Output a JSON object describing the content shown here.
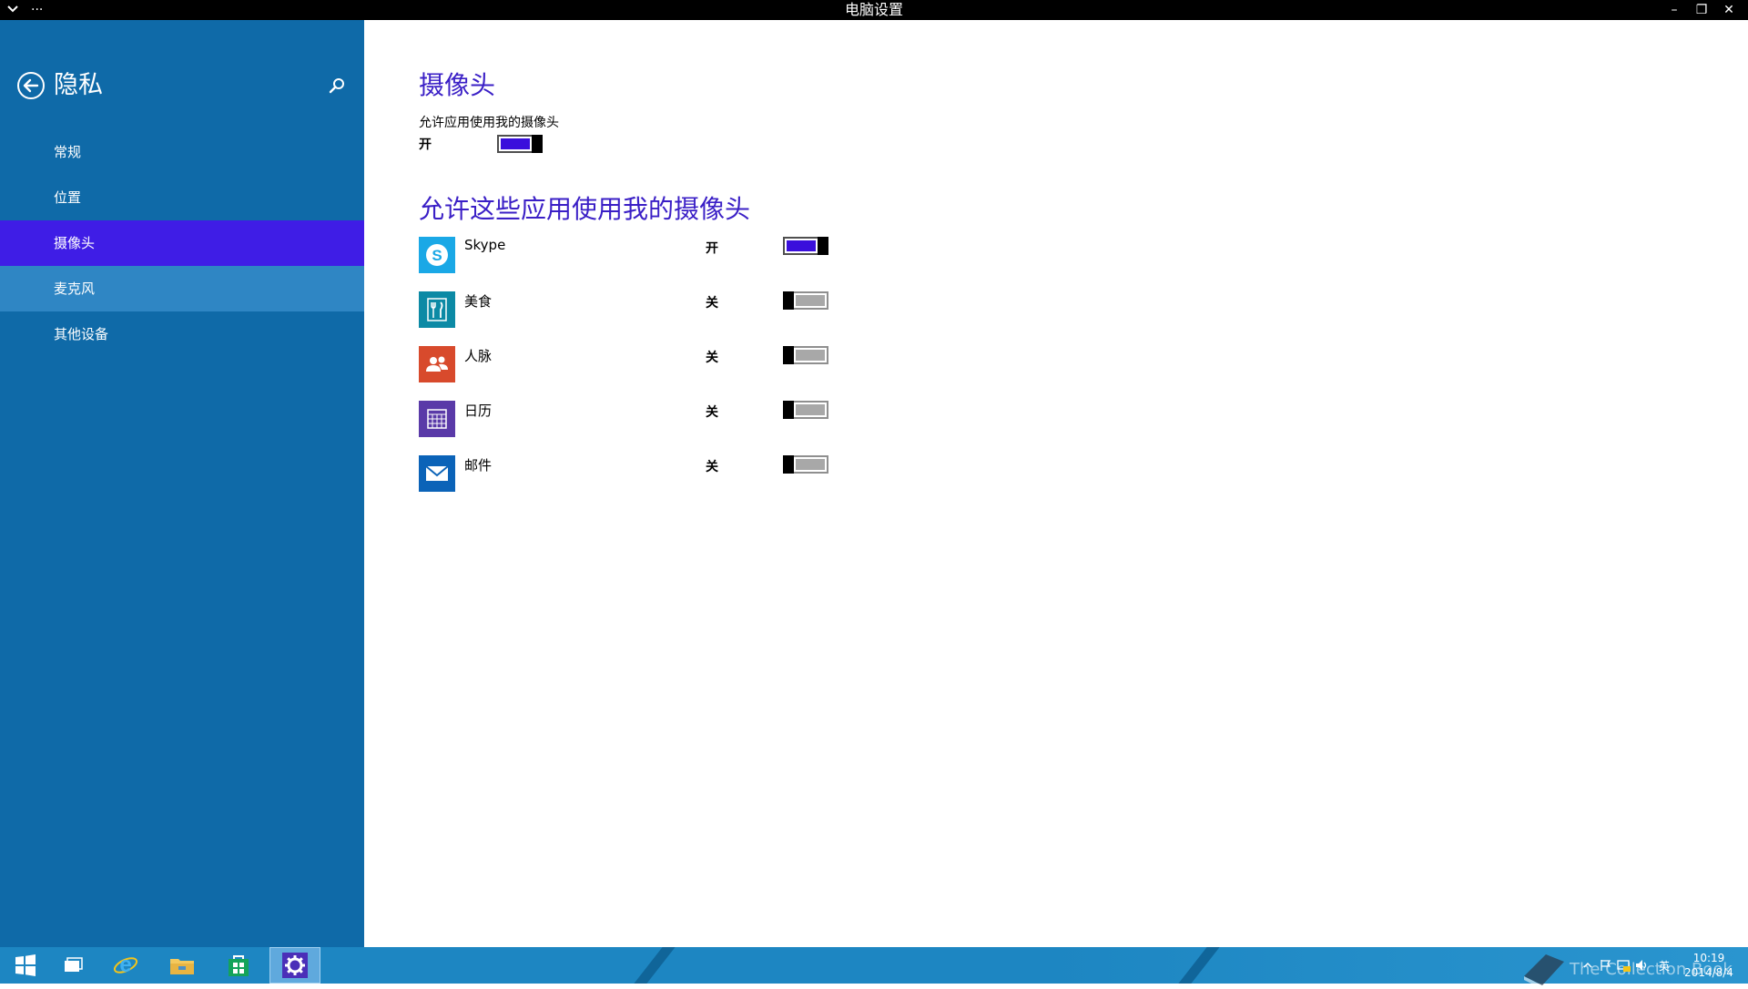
{
  "window": {
    "title": "电脑设置",
    "menu_dots": "···",
    "controls": {
      "minimize": "–",
      "restore": "❐",
      "close": "✕"
    }
  },
  "sidebar": {
    "title": "隐私",
    "items": [
      {
        "label": "常规"
      },
      {
        "label": "位置"
      },
      {
        "label": "摄像头"
      },
      {
        "label": "麦克风"
      },
      {
        "label": "其他设备"
      }
    ]
  },
  "content": {
    "heading": "摄像头",
    "master": {
      "description": "允许应用使用我的摄像头",
      "state_label": "开",
      "on": true
    },
    "apps_heading": "允许这些应用使用我的摄像头",
    "apps": [
      {
        "name": "Skype",
        "state_label": "开",
        "on": true,
        "icon": "skype-icon",
        "color": "#1aa8e6"
      },
      {
        "name": "美食",
        "state_label": "关",
        "on": false,
        "icon": "food-icon",
        "color": "#0c8aa5"
      },
      {
        "name": "人脉",
        "state_label": "关",
        "on": false,
        "icon": "people-icon",
        "color": "#d84a2c"
      },
      {
        "name": "日历",
        "state_label": "关",
        "on": false,
        "icon": "calendar-icon",
        "color": "#5a3aa8"
      },
      {
        "name": "邮件",
        "state_label": "关",
        "on": false,
        "icon": "mail-icon",
        "color": "#0b63b8"
      }
    ]
  },
  "taskbar": {
    "pinned": [
      "windows-start-icon",
      "task-view-icon",
      "internet-explorer-icon",
      "file-explorer-icon",
      "store-icon",
      "pc-settings-icon"
    ],
    "tray": {
      "ime": "英",
      "time": "10:19",
      "date": "2014/8/4"
    },
    "watermark": "The Collection Book"
  },
  "colors": {
    "sidebar": "#0f6aa8",
    "selected": "#3f1de6",
    "accent_heading": "#3a1fc6",
    "toggle_on": "#3a0fdc",
    "taskbar": "#1d86c2"
  }
}
